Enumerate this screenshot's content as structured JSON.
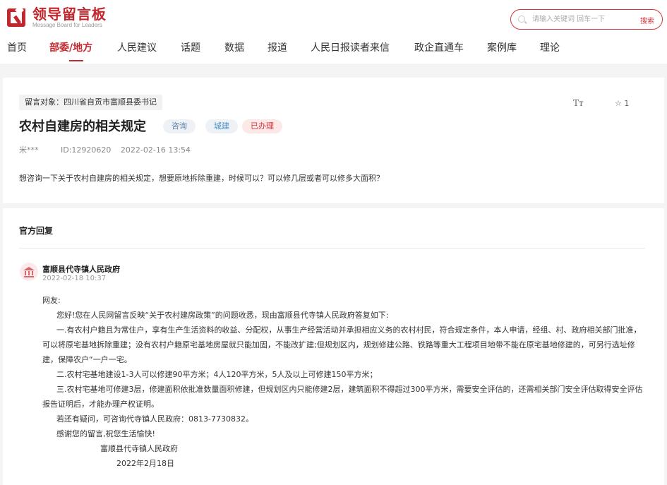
{
  "header": {
    "logo_cn": "领导留言板",
    "logo_en": "Message Board for Leaders",
    "search_placeholder": "请输入关键词 回车一下",
    "search_button": "搜索"
  },
  "nav": [
    {
      "label": "首页",
      "active": false
    },
    {
      "label": "部委/地方",
      "active": true
    },
    {
      "label": "人民建议",
      "active": false
    },
    {
      "label": "话题",
      "active": false
    },
    {
      "label": "数据",
      "active": false
    },
    {
      "label": "报道",
      "active": false
    },
    {
      "label": "人民日报读者来信",
      "active": false
    },
    {
      "label": "政企直通车",
      "active": false
    },
    {
      "label": "案例库",
      "active": false
    },
    {
      "label": "理论",
      "active": false
    }
  ],
  "message": {
    "target": "留言对象：四川省自贡市富顺县委书记",
    "title": "农村自建房的相关规定",
    "tags": {
      "consult": "咨询",
      "city": "城建",
      "done": "已办理"
    },
    "author": "米***",
    "id": "ID:12920620",
    "datetime": "2022-02-16 13:54",
    "font_size_label": "Tт",
    "fav_count": "1",
    "content": "想咨询一下关于农村自建房的相关规定，想要原地拆除重建，时候可以？可以修几层或者可以修多大面积？"
  },
  "reply": {
    "heading": "官方回复",
    "org": "富顺县代寺镇人民政府",
    "date": "2022-02-18 10:37",
    "greeting": "网友:",
    "p1": "您好!您在人民网留言反映“关于农村建房政策”的问题收悉，现由富顺县代寺镇人民政府答复如下:",
    "p2": "一.有农村户籍且为常住户，享有生产生活资料的收益、分配权，从事生产经营活动并承担相应义务的农村村民，符合规定条件，本人申请，经组、村、政府相关部门批准，可以将原宅基地拆除重建；没有农村户籍原宅基地房屋就只能加固，不能改扩建;但规划区内，规划修建公路、铁路等重大工程项目地带不能在原宅基地修建的，可另行选址修建，保障农户“一户一宅。",
    "p3": "二.农村宅基地建设1-3人可以修建90平方米；4人120平方米，5人及以上可修建150平方米；",
    "p4": "三.农村宅基地可修建3层，修建面积依批准数量面积修建，但规划区内只能修建2层，建筑面积不得超过300平方米，需要安全评估的，还需相关部门安全评估取得安全评估报告证明后，才能办理产权证明。",
    "p5": "若还有疑问，可咨询代寺镇人民政府：0813-7730832。",
    "p6": "感谢您的留言,祝您生活愉快!",
    "sign_org": "富顺县代寺镇人民政府",
    "sign_date": "2022年2月18日"
  },
  "colors": {
    "brand": "#c3262c",
    "search_border": "#d9353b",
    "page_bg": "#f4f4f4"
  }
}
